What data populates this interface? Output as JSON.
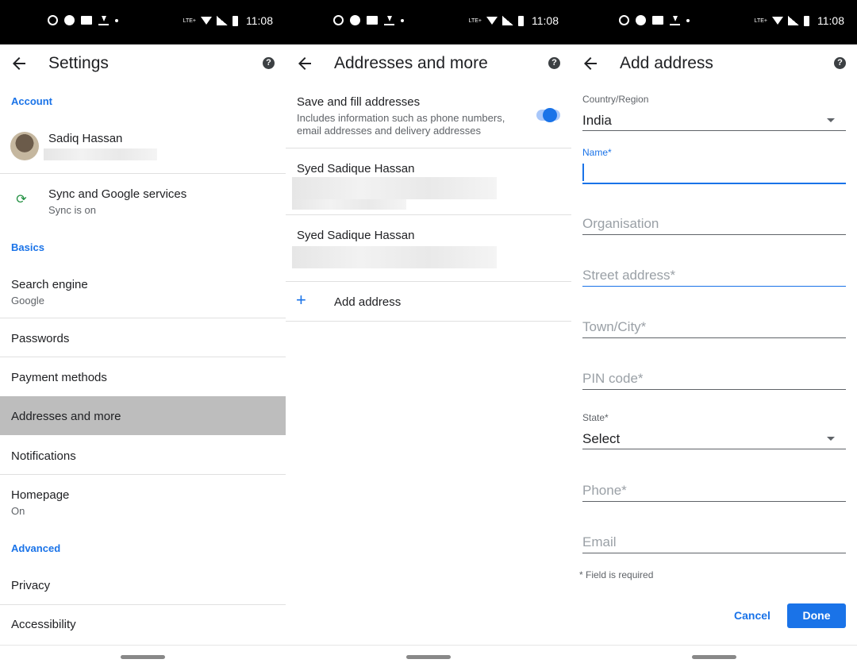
{
  "status_bar": {
    "time": "11:08",
    "lte": "LTE+"
  },
  "icons": {
    "back": "arrow-back-icon",
    "help": "help-icon",
    "sync": "sync-icon",
    "add": "plus-icon",
    "dropdown": "chevron-down-icon"
  },
  "colors": {
    "accent": "#1a73e8",
    "highlight": "#bdbdbd",
    "sync_green": "#1e8e3e"
  },
  "settings": {
    "title": "Settings",
    "help": "?",
    "account_header": "Account",
    "profile_name": "Sadiq Hassan",
    "sync_title": "Sync and Google services",
    "sync_status": "Sync is on",
    "basics_header": "Basics",
    "search_engine_title": "Search engine",
    "search_engine_value": "Google",
    "passwords": "Passwords",
    "payment_methods": "Payment methods",
    "addresses": "Addresses and more",
    "notifications": "Notifications",
    "homepage_title": "Homepage",
    "homepage_value": "On",
    "advanced_header": "Advanced",
    "privacy": "Privacy",
    "accessibility": "Accessibility"
  },
  "addresses": {
    "title": "Addresses and more",
    "help": "?",
    "save_fill_title": "Save and fill addresses",
    "save_fill_desc_line1": "Includes information such as phone numbers,",
    "save_fill_desc_line2": "email addresses and delivery addresses",
    "toggle_on": true,
    "saved": [
      {
        "name": "Syed Sadique Hassan"
      },
      {
        "name": "Syed Sadique Hassan"
      }
    ],
    "add_plus": "+",
    "add_label": "Add address"
  },
  "add_address": {
    "title": "Add address",
    "help": "?",
    "country_label": "Country/Region",
    "country_value": "India",
    "name_label": "Name*",
    "organisation_placeholder": "Organisation",
    "street_placeholder": "Street address*",
    "town_placeholder": "Town/City*",
    "pin_placeholder": "PIN code*",
    "state_label": "State*",
    "state_value": "Select",
    "phone_placeholder": "Phone*",
    "email_placeholder": "Email",
    "required_note": "* Field is required",
    "cancel": "Cancel",
    "done": "Done"
  }
}
